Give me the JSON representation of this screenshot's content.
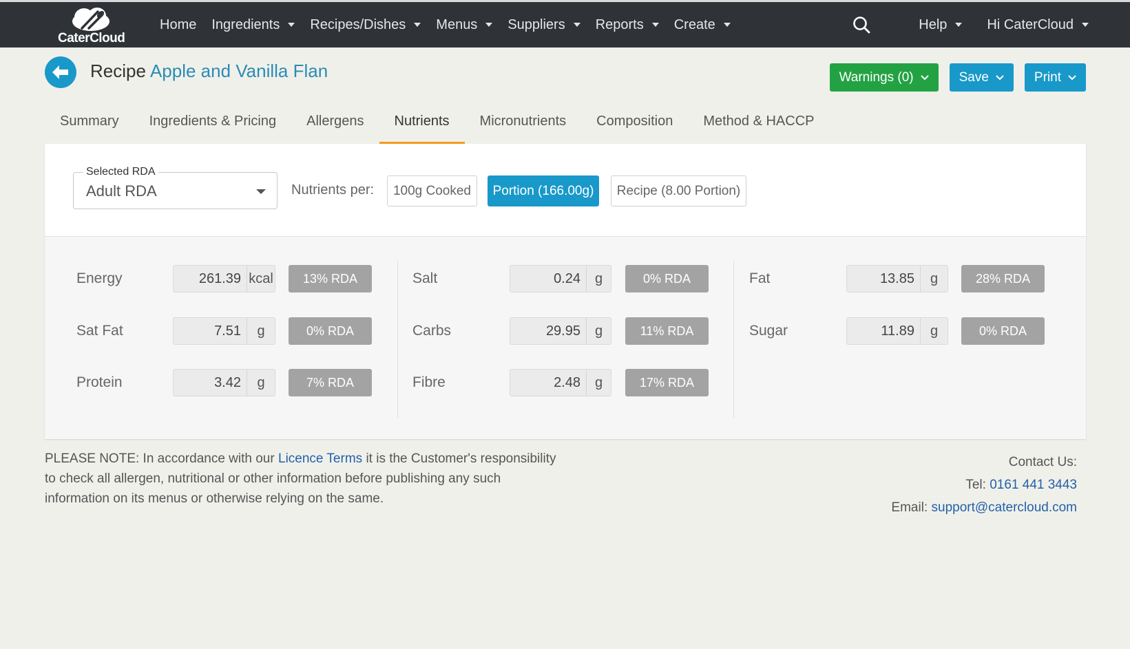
{
  "app": {
    "logo_text": "CaterCloud",
    "logo_icon": "cutlery-cloud-logo"
  },
  "nav": {
    "items": [
      {
        "label": "Home",
        "dropdown": false
      },
      {
        "label": "Ingredients",
        "dropdown": true
      },
      {
        "label": "Recipes/Dishes",
        "dropdown": true
      },
      {
        "label": "Menus",
        "dropdown": true
      },
      {
        "label": "Suppliers",
        "dropdown": true
      },
      {
        "label": "Reports",
        "dropdown": true
      },
      {
        "label": "Create",
        "dropdown": true
      }
    ],
    "help": "Help",
    "user": "Hi CaterCloud"
  },
  "header": {
    "prefix": "Recipe",
    "name": "Apple and Vanilla Flan",
    "warnings": "Warnings (0)",
    "save": "Save",
    "print": "Print"
  },
  "tabs": [
    {
      "label": "Summary"
    },
    {
      "label": "Ingredients & Pricing"
    },
    {
      "label": "Allergens"
    },
    {
      "label": "Nutrients"
    },
    {
      "label": "Micronutrients"
    },
    {
      "label": "Composition"
    },
    {
      "label": "Method & HACCP"
    }
  ],
  "active_tab": "Nutrients",
  "controls": {
    "rda_legend": "Selected RDA",
    "rda_value": "Adult RDA",
    "per_label": "Nutrients per:",
    "per_options": [
      "100g Cooked",
      "Portion (166.00g)",
      "Recipe (8.00 Portion)"
    ],
    "per_selected": "Portion (166.00g)"
  },
  "nutrients": [
    {
      "label": "Energy",
      "value": "261.39",
      "unit": "kcal",
      "rda": "13% RDA"
    },
    {
      "label": "Salt",
      "value": "0.24",
      "unit": "g",
      "rda": "0% RDA"
    },
    {
      "label": "Fat",
      "value": "13.85",
      "unit": "g",
      "rda": "28% RDA"
    },
    {
      "label": "Sat Fat",
      "value": "7.51",
      "unit": "g",
      "rda": "0% RDA"
    },
    {
      "label": "Carbs",
      "value": "29.95",
      "unit": "g",
      "rda": "11% RDA"
    },
    {
      "label": "Sugar",
      "value": "11.89",
      "unit": "g",
      "rda": "0% RDA"
    },
    {
      "label": "Protein",
      "value": "3.42",
      "unit": "g",
      "rda": "7% RDA"
    },
    {
      "label": "Fibre",
      "value": "2.48",
      "unit": "g",
      "rda": "17% RDA"
    }
  ],
  "footer": {
    "note_pre": "PLEASE NOTE: In accordance with our",
    "note_link": "Licence Terms",
    "note_post": "it is the Customer's responsibility to check all allergen, nutritional or other information before publishing any such information on its menus or otherwise relying on the same.",
    "contact_title": "Contact Us:",
    "tel_label": "Tel:",
    "tel": "0161 441 3443",
    "email_label": "Email:",
    "email": "support@catercloud.com"
  },
  "colors": {
    "nav_bg": "#2f3337",
    "primary": "#1899c9",
    "success": "#23a244",
    "tab_accent": "#f39c1f",
    "rda_badge": "#a3a3a3",
    "link": "#2361a8"
  }
}
